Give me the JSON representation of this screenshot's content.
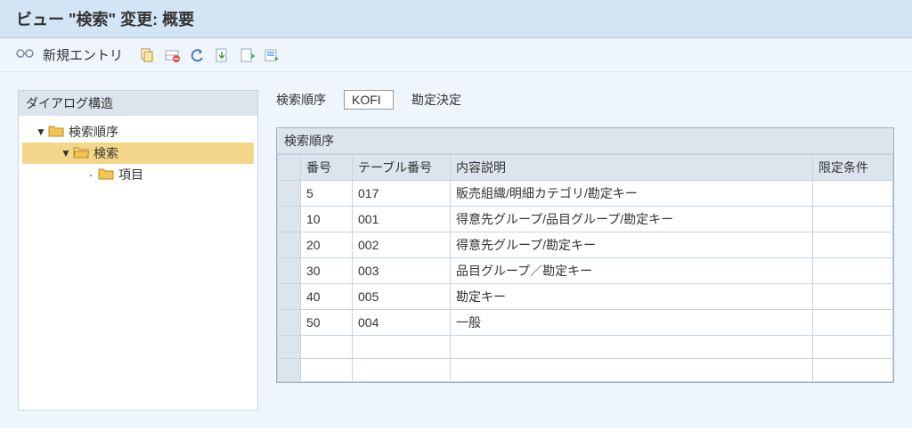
{
  "header": {
    "title": "ビュー \"検索\" 変更: 概要"
  },
  "toolbar": {
    "new_entry_label": "新規エントリ"
  },
  "tree": {
    "header": "ダイアログ構造",
    "nodes": {
      "root": {
        "label": "検索順序"
      },
      "search": {
        "label": "検索"
      },
      "item": {
        "label": "項目"
      }
    }
  },
  "field": {
    "label": "検索順序",
    "value": "KOFI",
    "desc": "勘定決定"
  },
  "grid": {
    "title": "検索順序",
    "columns": {
      "num": "番号",
      "table_no": "テーブル番号",
      "desc": "内容説明",
      "cond": "限定条件"
    },
    "rows": [
      {
        "num": "5",
        "table_no": "017",
        "desc": "販売組織/明細カテゴリ/勘定キー",
        "cond": ""
      },
      {
        "num": "10",
        "table_no": "001",
        "desc": "得意先グループ/品目グループ/勘定キー",
        "cond": ""
      },
      {
        "num": "20",
        "table_no": "002",
        "desc": "得意先グループ/勘定キー",
        "cond": ""
      },
      {
        "num": "30",
        "table_no": "003",
        "desc": "品目グループ／勘定キー",
        "cond": ""
      },
      {
        "num": "40",
        "table_no": "005",
        "desc": "勘定キー",
        "cond": ""
      },
      {
        "num": "50",
        "table_no": "004",
        "desc": "一般",
        "cond": ""
      }
    ]
  }
}
